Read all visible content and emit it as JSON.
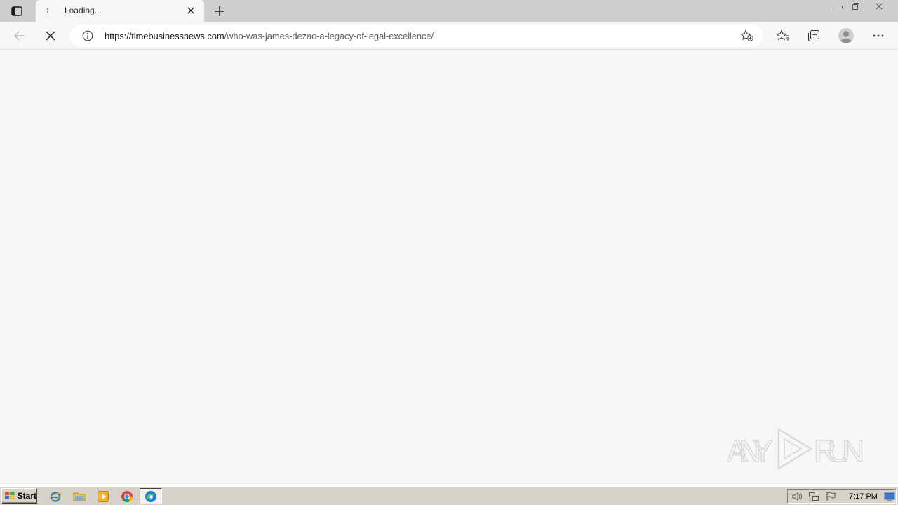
{
  "tab": {
    "title": "Loading...",
    "close_label": "✕",
    "newtab_label": "+"
  },
  "address": {
    "url_host": "https://timebusinessnews.com",
    "url_path": "/who-was-james-dezao-a-legacy-of-legal-excellence/"
  },
  "watermark": {
    "left": "ANY",
    "right": "RUN"
  },
  "taskbar": {
    "start_label": "Start",
    "clock": "7:17 PM"
  },
  "colors": {
    "tabstrip": "#cfcfcf",
    "page_bg": "#f7f7f7",
    "taskbar": "#d6d2c9"
  }
}
